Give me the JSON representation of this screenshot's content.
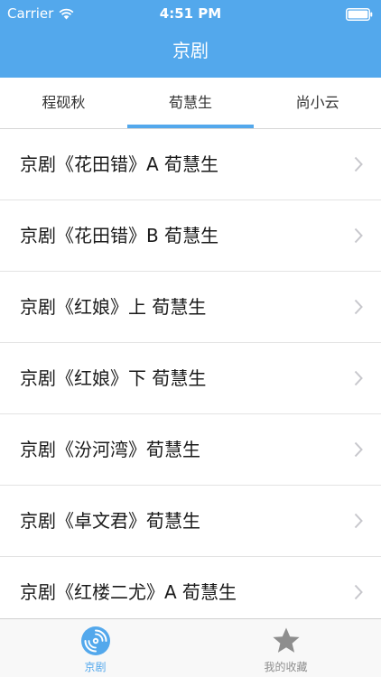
{
  "status_bar": {
    "carrier": "Carrier",
    "time": "4:51 PM"
  },
  "nav": {
    "title": "京剧"
  },
  "tabs": [
    {
      "label": "程砚秋",
      "selected": false
    },
    {
      "label": "荀慧生",
      "selected": true
    },
    {
      "label": "尚小云",
      "selected": false
    }
  ],
  "list": {
    "items": [
      {
        "label": "京剧《花田错》A 荀慧生"
      },
      {
        "label": "京剧《花田错》B 荀慧生"
      },
      {
        "label": "京剧《红娘》上 荀慧生"
      },
      {
        "label": "京剧《红娘》下 荀慧生"
      },
      {
        "label": "京剧《汾河湾》荀慧生"
      },
      {
        "label": "京剧《卓文君》荀慧生"
      },
      {
        "label": "京剧《红楼二尤》A 荀慧生"
      }
    ]
  },
  "tabbar": {
    "items": [
      {
        "label": "京剧",
        "icon": "disc-icon",
        "active": true
      },
      {
        "label": "我的收藏",
        "icon": "star-icon",
        "active": false
      }
    ]
  },
  "colors": {
    "accent": "#53a8ec",
    "inactive_icon": "#8e8e8e",
    "chevron": "#c7c7cc"
  }
}
